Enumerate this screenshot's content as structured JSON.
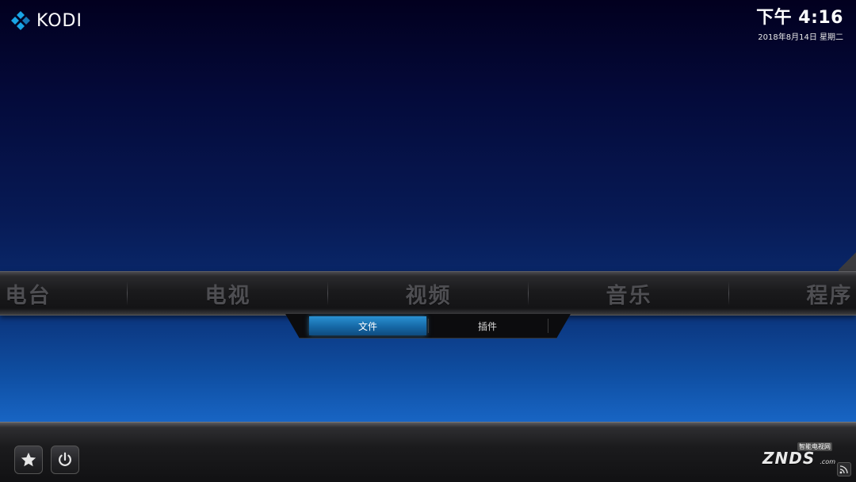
{
  "app": {
    "brand": "KODI",
    "logo_icon": "kodi-logo-icon"
  },
  "clock": {
    "time": "下午 4:16",
    "date": "2018年8月14日 星期二"
  },
  "main_menu": {
    "items": [
      {
        "label": "电台",
        "id": "radio"
      },
      {
        "label": "电视",
        "id": "tv"
      },
      {
        "label": "视频",
        "id": "videos"
      },
      {
        "label": "音乐",
        "id": "music"
      },
      {
        "label": "程序",
        "id": "programs"
      }
    ],
    "text_color": "#4e4e52"
  },
  "sub_menu": {
    "items": [
      {
        "label": "文件",
        "active": true
      },
      {
        "label": "插件",
        "active": false
      }
    ],
    "active_color": "#1e7fc2"
  },
  "bottom_bar": {
    "favourites_icon": "star-icon",
    "power_icon": "power-icon",
    "feed_icon": "rss-icon"
  },
  "watermark": {
    "top_text": "智能电视网",
    "main_text": "ZNDS",
    "sub_text": ".com"
  }
}
